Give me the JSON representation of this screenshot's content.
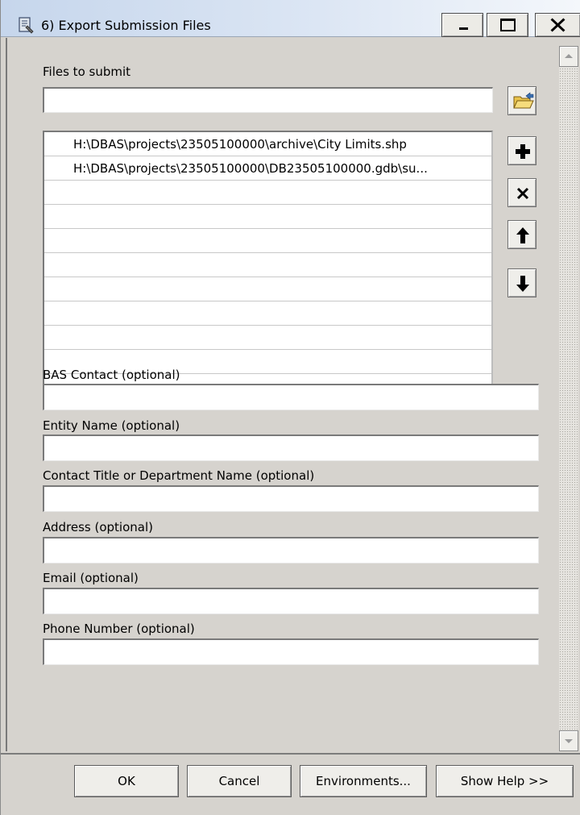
{
  "window": {
    "title": "6) Export Submission Files",
    "icon": "script-tool-icon",
    "controls": [
      "minimize",
      "maximize",
      "close"
    ]
  },
  "form": {
    "files_label": "Files to submit",
    "files_input_value": "",
    "file_list": [
      "H:\\DBAS\\projects\\23505100000\\archive\\City Limits.shp",
      "H:\\DBAS\\projects\\23505100000\\DB23505100000.gdb\\su..."
    ],
    "list_buttons": {
      "browse": "folder-open-icon",
      "add": "plus-icon",
      "remove": "x-icon",
      "move_up": "arrow-up-icon",
      "move_down": "arrow-down-icon"
    },
    "bas_contact_label": "BAS Contact (optional)",
    "bas_contact_value": "",
    "entity_name_label": "Entity Name (optional)",
    "entity_name_value": "",
    "contact_title_label": "Contact Title or Department Name (optional)",
    "contact_title_value": "",
    "address_label": "Address (optional)",
    "address_value": "",
    "email_label": "Email (optional)",
    "email_value": "",
    "phone_label": "Phone Number (optional)",
    "phone_value": ""
  },
  "buttons": {
    "ok": "OK",
    "cancel": "Cancel",
    "environments": "Environments...",
    "show_help": "Show Help >>"
  }
}
